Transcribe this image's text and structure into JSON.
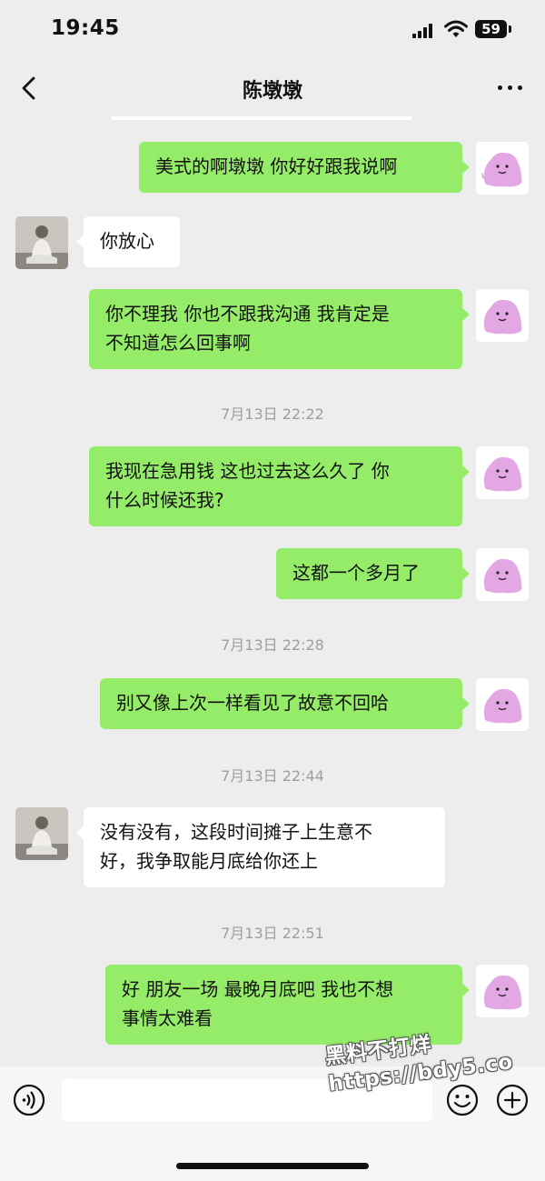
{
  "status_bar": {
    "time": "19:45",
    "battery": "59"
  },
  "nav": {
    "title": "陈墩墩",
    "back_icon": "chevron-left-icon",
    "more_icon": "ellipsis-icon"
  },
  "messages": [
    {
      "type": "outgoing",
      "text": "美式的啊墩墩 你好好跟我说啊"
    },
    {
      "type": "incoming",
      "text": "你放心"
    },
    {
      "type": "outgoing",
      "text": "你不理我 你也不跟我沟通 我肯定是\n不知道怎么回事啊"
    },
    {
      "type": "timestamp",
      "text": "7月13日 22:22"
    },
    {
      "type": "outgoing",
      "text": "我现在急用钱 这也过去这么久了 你\n什么时候还我?"
    },
    {
      "type": "outgoing",
      "text": "这都一个多月了"
    },
    {
      "type": "timestamp",
      "text": "7月13日 22:28"
    },
    {
      "type": "outgoing",
      "text": "别又像上次一样看见了故意不回哈"
    },
    {
      "type": "timestamp",
      "text": "7月13日 22:44"
    },
    {
      "type": "incoming",
      "text": "没有没有，这段时间摊子上生意不\n好，我争取能月底给你还上"
    },
    {
      "type": "timestamp",
      "text": "7月13日 22:51"
    },
    {
      "type": "outgoing",
      "text": "好 朋友一场 最晚月底吧 我也不想\n事情太难看"
    }
  ],
  "input_bar": {
    "voice_icon": "voice-icon",
    "input_value": "",
    "emoji_icon": "emoji-icon",
    "plus_icon": "plus-icon"
  },
  "watermark": {
    "line1": "黑料不打烊",
    "line2": "https://bdy5.co"
  },
  "colors": {
    "background": "#ededed",
    "outgoing_bubble": "#95ec69",
    "incoming_bubble": "#ffffff",
    "timestamp": "#9e9e9e"
  }
}
